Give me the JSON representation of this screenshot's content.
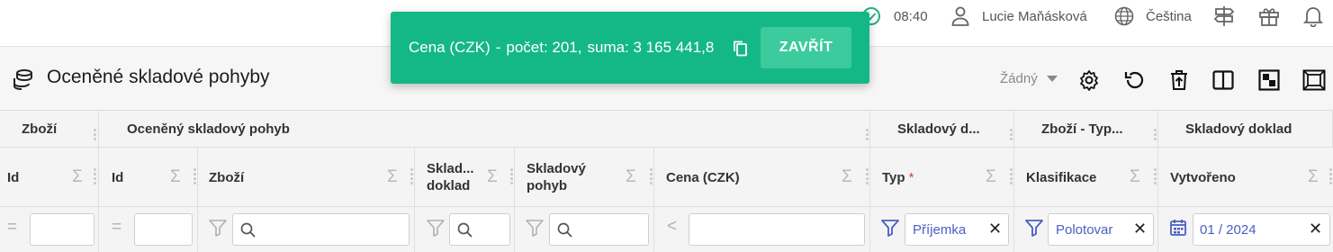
{
  "topbar": {
    "time": "08:40",
    "user": "Lucie Maňásková",
    "language": "Čeština"
  },
  "page": {
    "title": "Oceněné skladové pohyby",
    "view_select": "Žádný"
  },
  "toast": {
    "label": "Cena (CZK)",
    "sep": "-",
    "count": "počet: 201,",
    "sum": "suma: 3 165 441,8",
    "close": "ZAVŘÍT"
  },
  "grid": {
    "groups": [
      "Zboží",
      "Oceněný skladový pohyb",
      "Skladový d...",
      "Zboží - Typ...",
      "Skladový doklad"
    ],
    "columns": {
      "id1": "Id",
      "id2": "Id",
      "zbozi": "Zboží",
      "sklad_doklad_1": "Sklad...",
      "sklad_doklad_2": "doklad",
      "sklad_pohyb_1": "Skladový",
      "sklad_pohyb_2": "pohyb",
      "cena": "Cena (CZK)",
      "typ": "Typ",
      "typ_required": "*",
      "klasifikace": "Klasifikace",
      "vytvoreno": "Vytvořeno"
    },
    "filters": {
      "typ": "Příjemka",
      "klasifikace": "Polotovar",
      "vytvoreno": "01 / 2024"
    }
  },
  "colors": {
    "toast": "#14b886",
    "toast_button": "#3ccb9c",
    "chip_text": "#4a5fc1",
    "status_ok": "#1fb37f"
  }
}
